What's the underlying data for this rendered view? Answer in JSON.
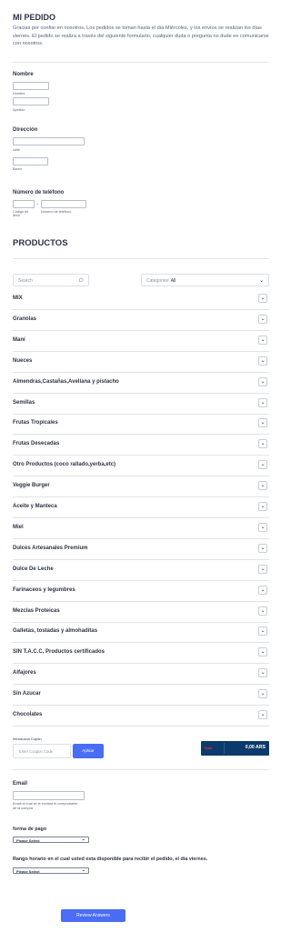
{
  "header": {
    "title": "MI PEDIDO",
    "intro": "Gracias por confiar en nosotros. Los pedidos se toman hasta el día Miércoles, y los envíos se realizan los días viernes. El pedido se realiza a través del siguiente formulario, cualquier duda o pregunta no dude en comunicarse con nosotros."
  },
  "name": {
    "label": "Nombre",
    "first_sub": "Nombre",
    "last_sub": "Apellido"
  },
  "address": {
    "label": "Dirección",
    "street_sub": "calle",
    "district_sub": "Barrio"
  },
  "phone": {
    "label": "Número de teléfono",
    "area_sub": "Código de área",
    "number_sub": "Número de teléfono",
    "dash": "-"
  },
  "products": {
    "title": "PRODUCTOS",
    "search_placeholder": "Search",
    "categories_label": "Categories:",
    "categories_value": "All",
    "chevron": "⌄",
    "categories": [
      "MIX",
      "Granolas",
      "Maní",
      "Nueces",
      "Almendras,Castañas,Avellana y pistacho",
      "Semillas",
      "Frutas Tropicales",
      "Frutas Desecadas",
      "Otro Productos (coco rallado,yerba,etc)",
      "Veggie Burger",
      "Aceite y Manteca",
      "Miel",
      "Dulces Artesanales Premium",
      "Dulce De Leche",
      "Farinaceos y legumbres",
      "Mezclas Proteicas",
      "Galletas, tostadas y almohaditas",
      "SIN T.A.C.C, Productos certificados",
      "Alfajores",
      "Sin Azucar",
      "Chocolates"
    ]
  },
  "coupon": {
    "label": "Introduzca Cupón",
    "placeholder": "Enter Coupon Code",
    "apply": "Aplicar"
  },
  "total": {
    "label": "Total",
    "value": "0,00 ARS"
  },
  "email": {
    "label": "Email",
    "sub": "Email al cual se le enviará el comprobante de la compra"
  },
  "payment": {
    "label": "forma de pago",
    "value": "Please Select"
  },
  "schedule": {
    "label": "Rango horario en el cual usted esta disponible para recibir el pedido, el dia viernes.",
    "value": "Please Select"
  },
  "submit": {
    "label": "Review Answers"
  },
  "colors": {
    "primary": "#4b6cf5",
    "total_bg": "#0b3a6c",
    "total_label": "#e0342b",
    "text": "#2c3345"
  }
}
